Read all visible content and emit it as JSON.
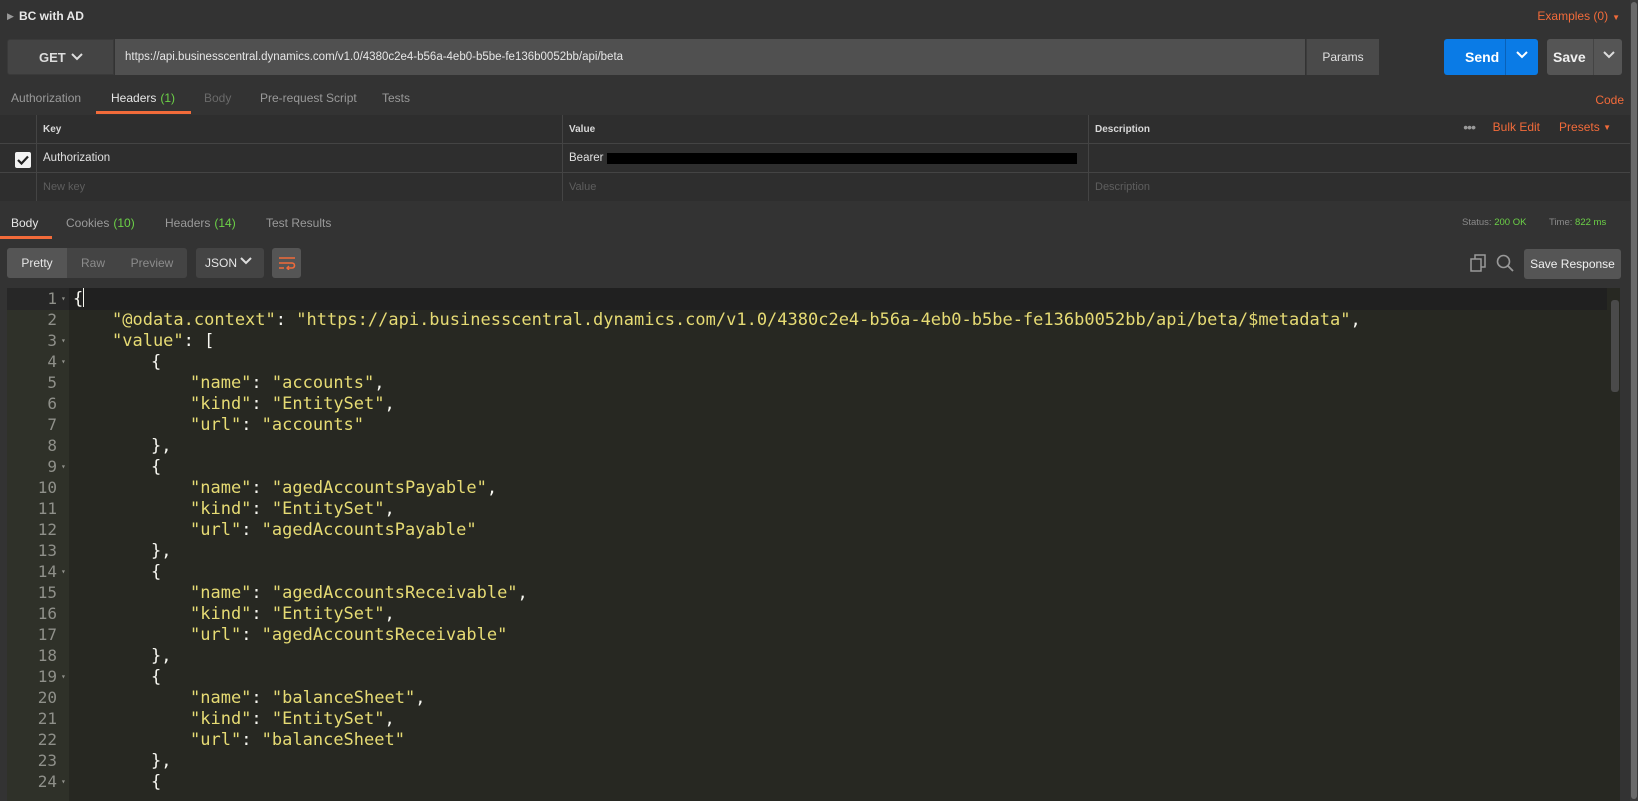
{
  "request": {
    "name": "BC with AD",
    "examples_label": "Examples (0)",
    "method": "GET",
    "url": "https://api.businesscentral.dynamics.com/v1.0/4380c2e4-b56a-4eb0-b5be-fe136b0052bb/api/beta",
    "params_label": "Params",
    "send_label": "Send",
    "save_label": "Save",
    "code_label": "Code"
  },
  "request_tabs": [
    {
      "label": "Authorization",
      "count": "",
      "state": "normal"
    },
    {
      "label": "Headers",
      "count": "(1)",
      "state": "active"
    },
    {
      "label": "Body",
      "count": "",
      "state": "disabled"
    },
    {
      "label": "Pre-request Script",
      "count": "",
      "state": "normal"
    },
    {
      "label": "Tests",
      "count": "",
      "state": "normal"
    }
  ],
  "headers_table": {
    "columns": [
      "Key",
      "Value",
      "Description"
    ],
    "bulk_edit_label": "Bulk Edit",
    "presets_label": "Presets",
    "more_label": "•••",
    "rows": [
      {
        "checked": true,
        "key": "Authorization",
        "value": "Bearer",
        "description": ""
      }
    ],
    "new_row": {
      "key_placeholder": "New key",
      "value_placeholder": "Value",
      "description_placeholder": "Description"
    }
  },
  "response_tabs": [
    {
      "label": "Body",
      "count": "",
      "state": "active"
    },
    {
      "label": "Cookies",
      "count": "(10)",
      "state": "normal"
    },
    {
      "label": "Headers",
      "count": "(14)",
      "state": "normal"
    },
    {
      "label": "Test Results",
      "count": "",
      "state": "normal"
    }
  ],
  "response_status": {
    "status_label": "Status:",
    "status_value": "200 OK",
    "time_label": "Time:",
    "time_value": "822 ms"
  },
  "view_options": {
    "modes": [
      "Pretty",
      "Raw",
      "Preview"
    ],
    "active_mode": "Pretty",
    "format": "JSON",
    "save_response_label": "Save Response"
  },
  "editor_lines": [
    {
      "n": "1",
      "fold": true,
      "indent": 0,
      "html": "{"
    },
    {
      "n": "2",
      "fold": false,
      "indent": 1,
      "key": "@odata.context",
      "val": "https://api.businesscentral.dynamics.com/v1.0/4380c2e4-b56a-4eb0-b5be-fe136b0052bb/api/beta/$metadata",
      "trail": ","
    },
    {
      "n": "3",
      "fold": true,
      "indent": 1,
      "key": "value",
      "raw": "[",
      "trail": ""
    },
    {
      "n": "4",
      "fold": true,
      "indent": 2,
      "html": "{"
    },
    {
      "n": "5",
      "fold": false,
      "indent": 3,
      "key": "name",
      "val": "accounts",
      "trail": ","
    },
    {
      "n": "6",
      "fold": false,
      "indent": 3,
      "key": "kind",
      "val": "EntitySet",
      "trail": ","
    },
    {
      "n": "7",
      "fold": false,
      "indent": 3,
      "key": "url",
      "val": "accounts",
      "trail": ""
    },
    {
      "n": "8",
      "fold": false,
      "indent": 2,
      "html": "},"
    },
    {
      "n": "9",
      "fold": true,
      "indent": 2,
      "html": "{"
    },
    {
      "n": "10",
      "fold": false,
      "indent": 3,
      "key": "name",
      "val": "agedAccountsPayable",
      "trail": ","
    },
    {
      "n": "11",
      "fold": false,
      "indent": 3,
      "key": "kind",
      "val": "EntitySet",
      "trail": ","
    },
    {
      "n": "12",
      "fold": false,
      "indent": 3,
      "key": "url",
      "val": "agedAccountsPayable",
      "trail": ""
    },
    {
      "n": "13",
      "fold": false,
      "indent": 2,
      "html": "},"
    },
    {
      "n": "14",
      "fold": true,
      "indent": 2,
      "html": "{"
    },
    {
      "n": "15",
      "fold": false,
      "indent": 3,
      "key": "name",
      "val": "agedAccountsReceivable",
      "trail": ","
    },
    {
      "n": "16",
      "fold": false,
      "indent": 3,
      "key": "kind",
      "val": "EntitySet",
      "trail": ","
    },
    {
      "n": "17",
      "fold": false,
      "indent": 3,
      "key": "url",
      "val": "agedAccountsReceivable",
      "trail": ""
    },
    {
      "n": "18",
      "fold": false,
      "indent": 2,
      "html": "},"
    },
    {
      "n": "19",
      "fold": true,
      "indent": 2,
      "html": "{"
    },
    {
      "n": "20",
      "fold": false,
      "indent": 3,
      "key": "name",
      "val": "balanceSheet",
      "trail": ","
    },
    {
      "n": "21",
      "fold": false,
      "indent": 3,
      "key": "kind",
      "val": "EntitySet",
      "trail": ","
    },
    {
      "n": "22",
      "fold": false,
      "indent": 3,
      "key": "url",
      "val": "balanceSheet",
      "trail": ""
    },
    {
      "n": "23",
      "fold": false,
      "indent": 2,
      "html": "},"
    },
    {
      "n": "24",
      "fold": true,
      "indent": 2,
      "html": "{"
    }
  ],
  "colors": {
    "accent": "#f26b3a",
    "send": "#0a7be6",
    "ok": "#6cd147",
    "editor_bg": "#272822",
    "string": "#e6db74"
  }
}
